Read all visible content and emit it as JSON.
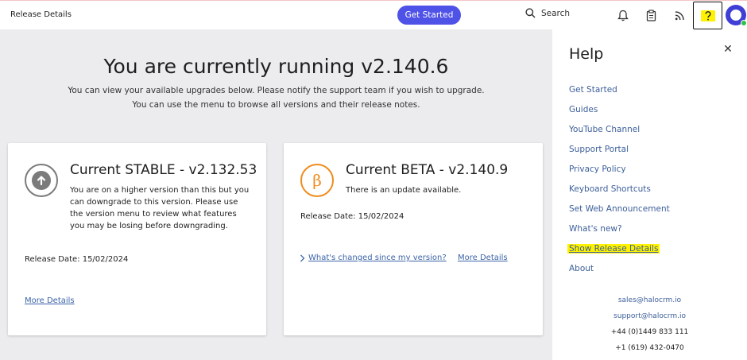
{
  "topbar": {
    "page_title": "Release Details",
    "get_started_label": "Get Started",
    "search_label": "Search"
  },
  "main": {
    "heading": "You are currently running v2.140.6",
    "subtext_line1": "You can view your available upgrades below. Please notify the support team if you wish to upgrade.",
    "subtext_line2": "You can use the menu to browse all versions and their release notes."
  },
  "stable_card": {
    "title": "Current STABLE - v2.132.53",
    "description": "You are on a higher version than this but you can downgrade to this version. Please use the version menu to review what features you may be losing before downgrading.",
    "release_date": "Release Date: 15/02/2024",
    "more_details": "More Details",
    "icon": "arrow-up-circle-icon",
    "icon_color": "#7b7b7b"
  },
  "beta_card": {
    "title": "Current BETA - v2.140.9",
    "description": "There is an update available.",
    "release_date": "Release Date: 15/02/2024",
    "changed_link": "What's changed since my version?",
    "more_details": "More Details",
    "icon_glyph": "β",
    "icon_color": "#f08c1e"
  },
  "help_panel": {
    "title": "Help",
    "links": [
      "Get Started",
      "Guides",
      "YouTube Channel",
      "Support Portal",
      "Privacy Policy",
      "Keyboard Shortcuts",
      "Set Web Announcement",
      "What's new?",
      "Show Release Details",
      "About"
    ],
    "contact_email_sales": "sales@halocrm.io",
    "contact_email_support": "support@halocrm.io",
    "phone_uk": "+44 (0)1449 833 111",
    "phone_us": "+1 (619) 432-0470"
  },
  "colors": {
    "accent": "#4f52e6",
    "highlight": "#fff200",
    "link": "#3c5f9a"
  }
}
